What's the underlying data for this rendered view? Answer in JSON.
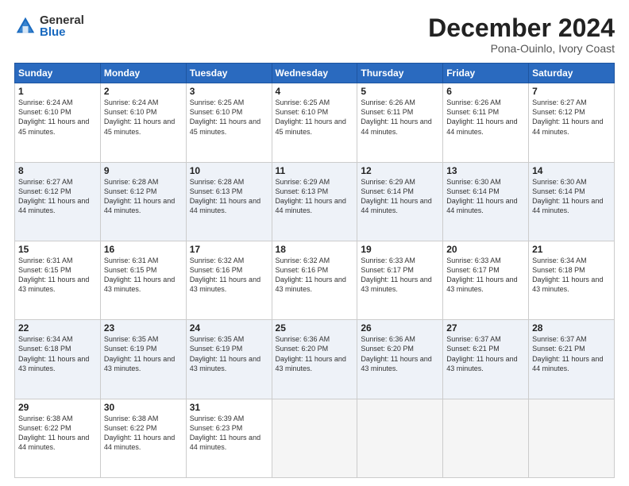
{
  "logo": {
    "general": "General",
    "blue": "Blue"
  },
  "title": "December 2024",
  "location": "Pona-Ouinlo, Ivory Coast",
  "days_of_week": [
    "Sunday",
    "Monday",
    "Tuesday",
    "Wednesday",
    "Thursday",
    "Friday",
    "Saturday"
  ],
  "weeks": [
    [
      {
        "day": "1",
        "sunrise": "6:24 AM",
        "sunset": "6:10 PM",
        "daylight": "11 hours and 45 minutes."
      },
      {
        "day": "2",
        "sunrise": "6:24 AM",
        "sunset": "6:10 PM",
        "daylight": "11 hours and 45 minutes."
      },
      {
        "day": "3",
        "sunrise": "6:25 AM",
        "sunset": "6:10 PM",
        "daylight": "11 hours and 45 minutes."
      },
      {
        "day": "4",
        "sunrise": "6:25 AM",
        "sunset": "6:10 PM",
        "daylight": "11 hours and 45 minutes."
      },
      {
        "day": "5",
        "sunrise": "6:26 AM",
        "sunset": "6:11 PM",
        "daylight": "11 hours and 44 minutes."
      },
      {
        "day": "6",
        "sunrise": "6:26 AM",
        "sunset": "6:11 PM",
        "daylight": "11 hours and 44 minutes."
      },
      {
        "day": "7",
        "sunrise": "6:27 AM",
        "sunset": "6:12 PM",
        "daylight": "11 hours and 44 minutes."
      }
    ],
    [
      {
        "day": "8",
        "sunrise": "6:27 AM",
        "sunset": "6:12 PM",
        "daylight": "11 hours and 44 minutes."
      },
      {
        "day": "9",
        "sunrise": "6:28 AM",
        "sunset": "6:12 PM",
        "daylight": "11 hours and 44 minutes."
      },
      {
        "day": "10",
        "sunrise": "6:28 AM",
        "sunset": "6:13 PM",
        "daylight": "11 hours and 44 minutes."
      },
      {
        "day": "11",
        "sunrise": "6:29 AM",
        "sunset": "6:13 PM",
        "daylight": "11 hours and 44 minutes."
      },
      {
        "day": "12",
        "sunrise": "6:29 AM",
        "sunset": "6:14 PM",
        "daylight": "11 hours and 44 minutes."
      },
      {
        "day": "13",
        "sunrise": "6:30 AM",
        "sunset": "6:14 PM",
        "daylight": "11 hours and 44 minutes."
      },
      {
        "day": "14",
        "sunrise": "6:30 AM",
        "sunset": "6:14 PM",
        "daylight": "11 hours and 44 minutes."
      }
    ],
    [
      {
        "day": "15",
        "sunrise": "6:31 AM",
        "sunset": "6:15 PM",
        "daylight": "11 hours and 43 minutes."
      },
      {
        "day": "16",
        "sunrise": "6:31 AM",
        "sunset": "6:15 PM",
        "daylight": "11 hours and 43 minutes."
      },
      {
        "day": "17",
        "sunrise": "6:32 AM",
        "sunset": "6:16 PM",
        "daylight": "11 hours and 43 minutes."
      },
      {
        "day": "18",
        "sunrise": "6:32 AM",
        "sunset": "6:16 PM",
        "daylight": "11 hours and 43 minutes."
      },
      {
        "day": "19",
        "sunrise": "6:33 AM",
        "sunset": "6:17 PM",
        "daylight": "11 hours and 43 minutes."
      },
      {
        "day": "20",
        "sunrise": "6:33 AM",
        "sunset": "6:17 PM",
        "daylight": "11 hours and 43 minutes."
      },
      {
        "day": "21",
        "sunrise": "6:34 AM",
        "sunset": "6:18 PM",
        "daylight": "11 hours and 43 minutes."
      }
    ],
    [
      {
        "day": "22",
        "sunrise": "6:34 AM",
        "sunset": "6:18 PM",
        "daylight": "11 hours and 43 minutes."
      },
      {
        "day": "23",
        "sunrise": "6:35 AM",
        "sunset": "6:19 PM",
        "daylight": "11 hours and 43 minutes."
      },
      {
        "day": "24",
        "sunrise": "6:35 AM",
        "sunset": "6:19 PM",
        "daylight": "11 hours and 43 minutes."
      },
      {
        "day": "25",
        "sunrise": "6:36 AM",
        "sunset": "6:20 PM",
        "daylight": "11 hours and 43 minutes."
      },
      {
        "day": "26",
        "sunrise": "6:36 AM",
        "sunset": "6:20 PM",
        "daylight": "11 hours and 43 minutes."
      },
      {
        "day": "27",
        "sunrise": "6:37 AM",
        "sunset": "6:21 PM",
        "daylight": "11 hours and 43 minutes."
      },
      {
        "day": "28",
        "sunrise": "6:37 AM",
        "sunset": "6:21 PM",
        "daylight": "11 hours and 44 minutes."
      }
    ],
    [
      {
        "day": "29",
        "sunrise": "6:38 AM",
        "sunset": "6:22 PM",
        "daylight": "11 hours and 44 minutes."
      },
      {
        "day": "30",
        "sunrise": "6:38 AM",
        "sunset": "6:22 PM",
        "daylight": "11 hours and 44 minutes."
      },
      {
        "day": "31",
        "sunrise": "6:39 AM",
        "sunset": "6:23 PM",
        "daylight": "11 hours and 44 minutes."
      },
      null,
      null,
      null,
      null
    ]
  ]
}
